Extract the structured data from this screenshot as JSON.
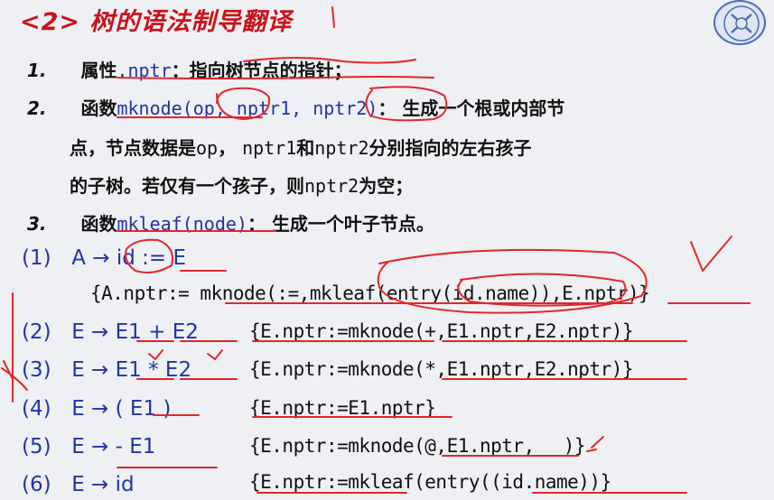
{
  "title": "<2> 树的语法制导翻译",
  "items": [
    {
      "num": "1.",
      "pre": "属性",
      "code": ".nptr",
      "post": "：指向树节点的指针；"
    },
    {
      "num": "2.",
      "pre": "函数",
      "code": "mknode(op, nptr1, nptr2)",
      "post": "：  生成一个根或内部节"
    },
    {
      "line2a": "点，节点数据是",
      "op": "op",
      "line2b": "，  ",
      "n1": "nptr1",
      "line2c": "和",
      "n2": "nptr2",
      "line2d": "分别指向的左右孩子"
    },
    {
      "line3a": "的子树。若仅有一个孩子，则",
      "n2": "nptr2",
      "line3b": "为空；"
    },
    {
      "num": "3.",
      "pre": "函数",
      "code": "mkleaf(node)",
      "post": "：  生成一个叶子节点。"
    }
  ],
  "rules": [
    {
      "id": "(1)",
      "prod": "A → id := E",
      "sem": "",
      "sem2": "{A.nptr:=  mknode(:=,mkleaf(entry(id.name)),E.nptr)}"
    },
    {
      "id": "(2)",
      "prod": "E → E1 + E2",
      "sem": "{E.nptr:=mknode(+,E1.nptr,E2.nptr)}"
    },
    {
      "id": "(3)",
      "prod": "E → E1 * E2",
      "sem": "{E.nptr:=mknode(*,E1.nptr,E2.nptr)}"
    },
    {
      "id": "(4)",
      "prod": "E → ( E1 )",
      "sem": "{E.nptr:=E1.nptr}"
    },
    {
      "id": "(5)",
      "prod": "E → - E1",
      "sem": "{E.nptr:=mknode(@,E1.nptr,",
      "sem_tail": ")}"
    },
    {
      "id": "(6)",
      "prod": "E → id",
      "sem": "{E.nptr:=mkleaf(entry((id.name))}"
    }
  ]
}
